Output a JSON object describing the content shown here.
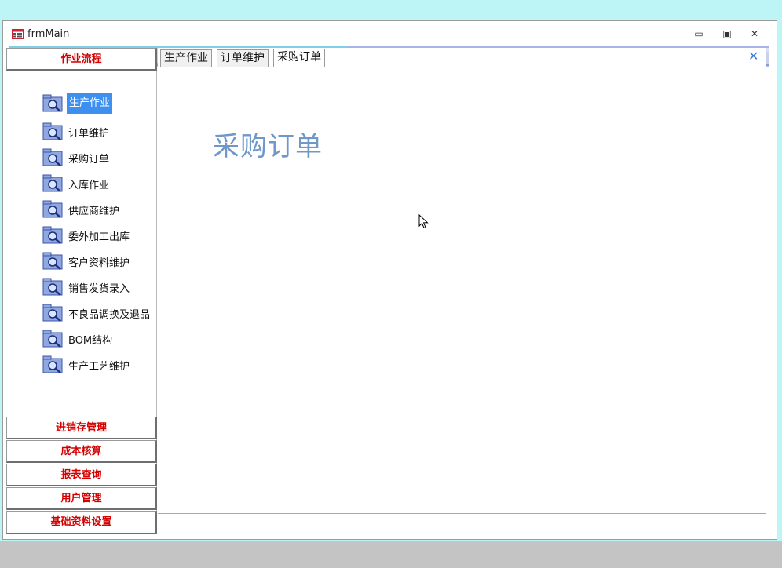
{
  "window": {
    "title": "frmMain",
    "controls": {
      "minimize": "▭",
      "maximize": "▣",
      "close": "✕"
    }
  },
  "sidebar": {
    "active_group": "作业流程",
    "items": [
      {
        "label": "生产作业",
        "icon": "search-folder-icon",
        "selected": true
      },
      {
        "label": "订单维护",
        "icon": "search-folder-icon"
      },
      {
        "label": "采购订单",
        "icon": "search-folder-icon"
      },
      {
        "label": "入库作业",
        "icon": "search-folder-icon"
      },
      {
        "label": "供应商维护",
        "icon": "search-folder-icon"
      },
      {
        "label": "委外加工出库",
        "icon": "search-folder-icon"
      },
      {
        "label": "客户资料维护",
        "icon": "search-folder-icon"
      },
      {
        "label": "销售发货录入",
        "icon": "search-folder-icon"
      },
      {
        "label": "不良品调换及退品",
        "icon": "search-folder-icon"
      },
      {
        "label": "BOM结构",
        "icon": "search-folder-icon"
      },
      {
        "label": "生产工艺维护",
        "icon": "search-folder-icon"
      }
    ],
    "groups": [
      "进销存管理",
      "成本核算",
      "报表查询",
      "用户管理",
      "基础资料设置"
    ]
  },
  "tabs": [
    {
      "label": "生产作业"
    },
    {
      "label": "订单维护"
    },
    {
      "label": "采购订单",
      "active": true
    }
  ],
  "tab_close": "✕",
  "content": {
    "title": "采购订单"
  },
  "colors": {
    "selection": "#3d8ff0",
    "group_text": "#d40000",
    "title_text": "#6f97c9",
    "desktop": "#bdf5f7"
  }
}
